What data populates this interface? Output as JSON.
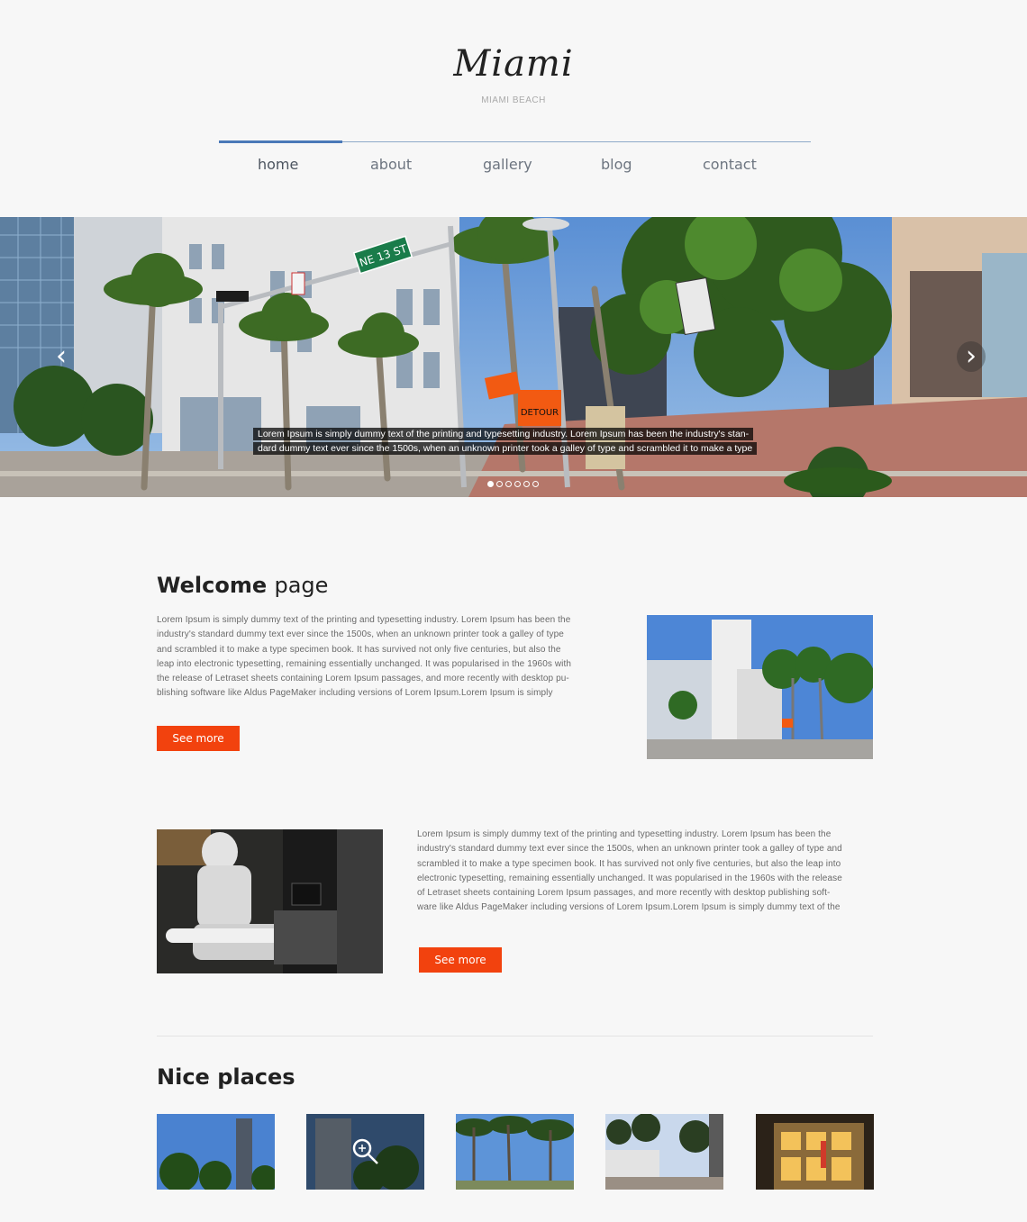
{
  "header": {
    "logo": "Miami",
    "tagline": "MIAMI BEACH"
  },
  "nav": {
    "items": [
      {
        "label": "home",
        "active": true
      },
      {
        "label": "about",
        "active": false
      },
      {
        "label": "gallery",
        "active": false
      },
      {
        "label": "blog",
        "active": false
      },
      {
        "label": "contact",
        "active": false
      }
    ]
  },
  "slider": {
    "caption_line1": "Lorem Ipsum is simply dummy text of the printing and typesetting industry. Lorem Ipsum has been the industry's stan-",
    "caption_line2": "dard dummy text ever since the 1500s, when an unknown printer took a galley of type and scrambled it to make a type",
    "sign_street": "NE 13 ST",
    "sign_detour": "DETOUR",
    "slide_count": 6,
    "active_slide": 1,
    "prev_icon": "chevron-left-icon",
    "next_icon": "chevron-right-icon"
  },
  "welcome": {
    "title_bold": "Welcome",
    "title_light": "page",
    "paragraph": [
      "Lorem Ipsum is simply dummy text of the printing and typesetting industry. Lorem Ipsum has been the",
      "industry's standard dummy text ever since the 1500s, when an unknown printer took a galley of type",
      "and scrambled it to make a type specimen book. It has survived not only five centuries, but also the",
      "leap into electronic typesetting, remaining essentially unchanged. It was popularised in the 1960s with",
      "the release of Letraset sheets containing Lorem Ipsum passages, and more recently with desktop pu-",
      "blishing software like Aldus PageMaker including versions of Lorem Ipsum.Lorem Ipsum is simply"
    ],
    "button": "See more"
  },
  "second": {
    "paragraph": [
      "Lorem Ipsum is simply dummy text of the printing and typesetting industry. Lorem Ipsum has been the",
      "industry's standard dummy text ever since the 1500s, when an unknown printer took a galley of type and",
      "scrambled it to make a type specimen book. It has survived not only five centuries, but also the leap into",
      "electronic typesetting, remaining essentially unchanged. It was popularised in the 1960s with the release",
      "of Letraset sheets containing Lorem Ipsum passages, and more recently with desktop publishing soft-",
      "ware like Aldus PageMaker including versions of Lorem Ipsum.Lorem Ipsum is simply dummy text of the"
    ],
    "button": "See more"
  },
  "places": {
    "title_light": "Nice",
    "title_bold": "places",
    "thumbs": [
      "tower-photo",
      "palms-zoom-photo",
      "palm-row-photo",
      "street-photo",
      "night-building-photo"
    ],
    "zoom_icon": "magnifier-icon"
  },
  "colors": {
    "accent": "#f2420e",
    "nav_active": "#4a79b8",
    "nav_line": "#8fa9c9"
  }
}
